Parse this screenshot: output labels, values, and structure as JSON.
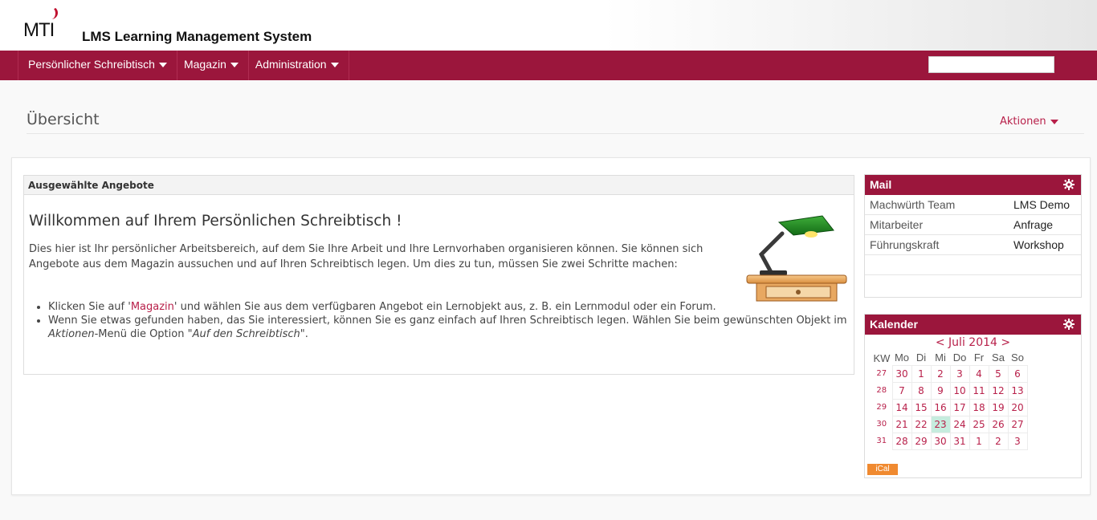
{
  "header": {
    "logo_text": "MTI",
    "app_title": "LMS Learning Management System"
  },
  "navbar": {
    "items": [
      {
        "label": "Persönlicher Schreibtisch"
      },
      {
        "label": "Magazin"
      },
      {
        "label": "Administration"
      }
    ],
    "search_value": ""
  },
  "page": {
    "title": "Übersicht",
    "actions_label": "Aktionen"
  },
  "featured": {
    "header": "Ausgewählte Angebote",
    "title": "Willkommen auf Ihrem Persönlichen Schreibtisch !",
    "intro": "Dies hier ist Ihr persönlicher Arbeitsbereich, auf dem Sie Ihre Arbeit und Ihre Lernvorhaben organisieren können. Sie können sich Angebote aus dem Magazin aussuchen und auf Ihren Schreibtisch legen. Um dies zu tun, müssen Sie zwei Schritte machen:",
    "bullet1_pre": "Klicken Sie auf '",
    "bullet1_link": "Magazin",
    "bullet1_post": "' und wählen Sie aus dem verfügbaren Angebot ein Lernobjekt aus, z. B. ein Lernmodul oder ein Forum.",
    "bullet2_pre": "Wenn Sie etwas gefunden haben, das Sie interessiert, können Sie es ganz einfach auf Ihren Schreibtisch legen. Wählen Sie beim gewünschten Objekt im ",
    "bullet2_em1": "Aktionen",
    "bullet2_mid": "-Menü die Option \"",
    "bullet2_em2": "Auf den Schreibtisch",
    "bullet2_post": "\"."
  },
  "mail": {
    "title": "Mail",
    "rows": [
      {
        "from": "Machwürth Team",
        "subject": "LMS Demo"
      },
      {
        "from": "Mitarbeiter",
        "subject": "Anfrage"
      },
      {
        "from": "Führungskraft",
        "subject": "Workshop"
      }
    ]
  },
  "calendar": {
    "title": "Kalender",
    "nav": "< Juli 2014 >",
    "headers": [
      "KW",
      "Mo",
      "Di",
      "Mi",
      "Do",
      "Fr",
      "Sa",
      "So"
    ],
    "weeks": [
      {
        "kw": "27",
        "days": [
          "30",
          "1",
          "2",
          "3",
          "4",
          "5",
          "6"
        ]
      },
      {
        "kw": "28",
        "days": [
          "7",
          "8",
          "9",
          "10",
          "11",
          "12",
          "13"
        ]
      },
      {
        "kw": "29",
        "days": [
          "14",
          "15",
          "16",
          "17",
          "18",
          "19",
          "20"
        ]
      },
      {
        "kw": "30",
        "days": [
          "21",
          "22",
          "23",
          "24",
          "25",
          "26",
          "27"
        ]
      },
      {
        "kw": "31",
        "days": [
          "28",
          "29",
          "30",
          "31",
          "1",
          "2",
          "3"
        ]
      }
    ],
    "today": "23",
    "ical_label": "iCal"
  },
  "colors": {
    "brand": "#9b163c",
    "link": "#b8204a",
    "today": "#c6ecde",
    "ical": "#f08a30"
  }
}
